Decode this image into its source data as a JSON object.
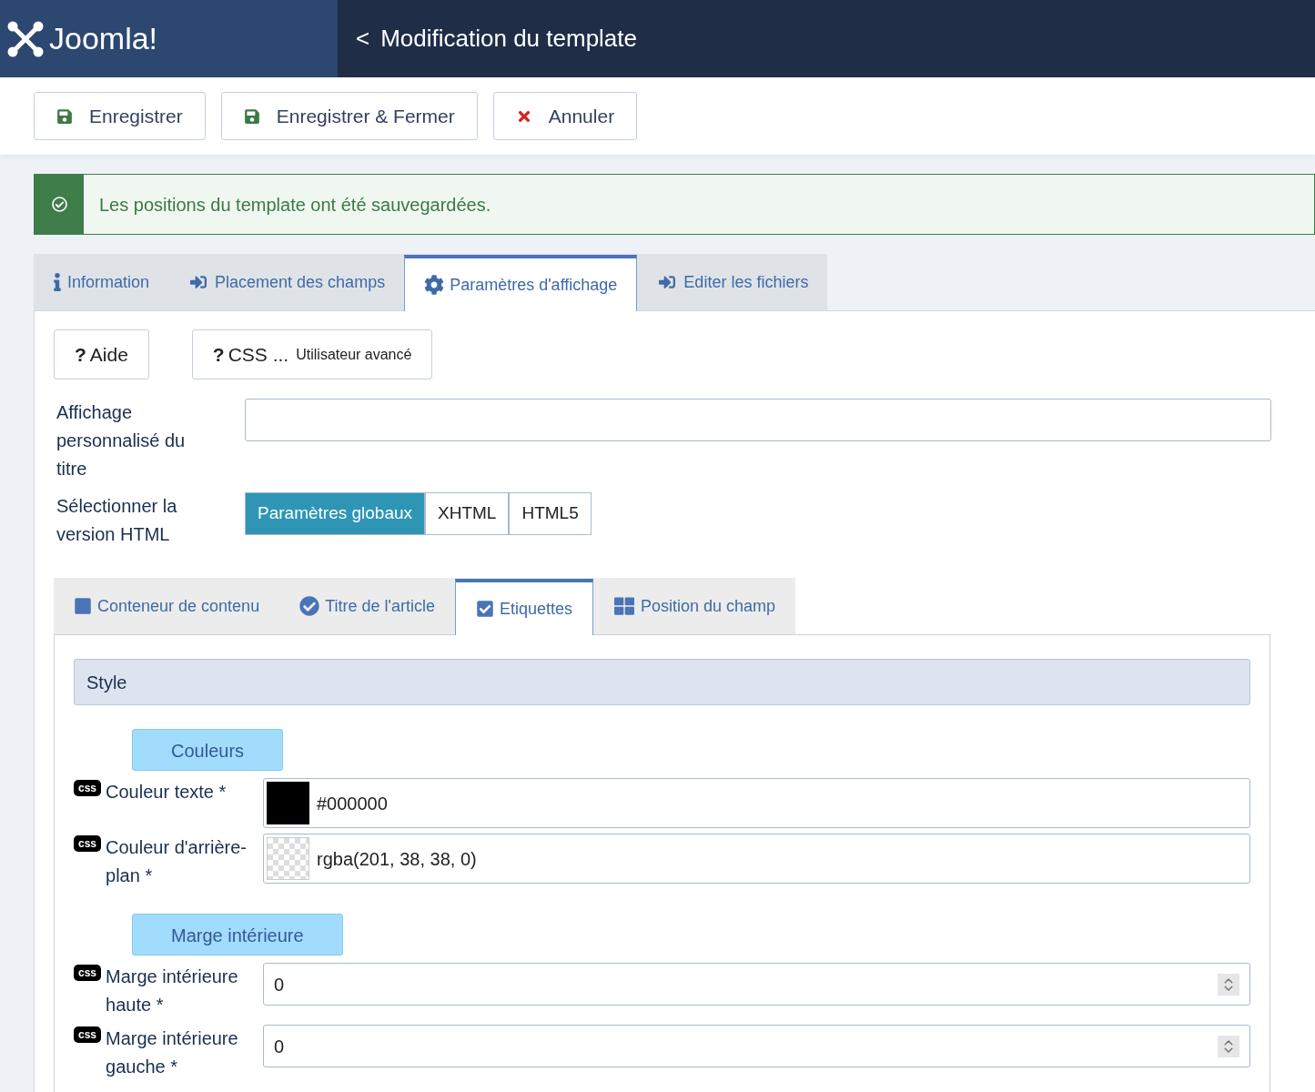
{
  "header": {
    "logo": "Joomla!",
    "back": "<",
    "title": "Modification du template"
  },
  "toolbar": [
    {
      "label": "Enregistrer",
      "kind": "save"
    },
    {
      "label": "Enregistrer & Fermer",
      "kind": "save"
    },
    {
      "label": "Annuler",
      "kind": "cancel"
    }
  ],
  "alert": {
    "message": "Les positions du template ont été sauvegardées."
  },
  "tabs": [
    {
      "label": "Information",
      "kind": "info",
      "selected": false
    },
    {
      "label": "Placement des champs",
      "kind": "signin",
      "selected": false
    },
    {
      "label": "Paramètres d'affichage",
      "kind": "settings",
      "selected": true
    },
    {
      "label": "Editer les fichiers",
      "kind": "signin",
      "selected": false
    }
  ],
  "help_buttons": [
    {
      "mark": "?",
      "label": "Aide"
    },
    {
      "mark": "?",
      "label": "CSS ...",
      "sub": "Utilisateur avancé"
    }
  ],
  "title_field": {
    "label": "Affichage personnalisé du titre"
  },
  "html_version": {
    "label": "Sélectionner la version HTML",
    "options": [
      {
        "label": "Paramètres globaux",
        "selected": true
      },
      {
        "label": "XHTML",
        "selected": false
      },
      {
        "label": "HTML5",
        "selected": false
      }
    ]
  },
  "subtabs": [
    {
      "label": "Conteneur de contenu",
      "kind": "square",
      "selected": false
    },
    {
      "label": "Titre de l'article",
      "kind": "circlecheck",
      "selected": false
    },
    {
      "label": "Etiquettes",
      "kind": "checkbox",
      "selected": true
    },
    {
      "label": "Position du champ",
      "kind": "grid",
      "selected": false
    }
  ],
  "section": {
    "title": "Style",
    "groups": [
      {
        "title": "Couleurs",
        "fields": [
          {
            "badge": "css",
            "label": "Couleur texte *",
            "kind": "color",
            "color": "#000000",
            "value": "#000000"
          },
          {
            "badge": "css",
            "label": "Couleur d'arrière-plan *",
            "kind": "clearcolor",
            "value": "rgba(201, 38, 38, 0)"
          }
        ]
      },
      {
        "title": "Marge intérieure",
        "fields": [
          {
            "badge": "css",
            "label": "Marge intérieure haute *",
            "kind": "number",
            "value": "0"
          },
          {
            "badge": "css",
            "label": "Marge intérieure gauche *",
            "kind": "number",
            "value": "0"
          }
        ]
      }
    ]
  }
}
